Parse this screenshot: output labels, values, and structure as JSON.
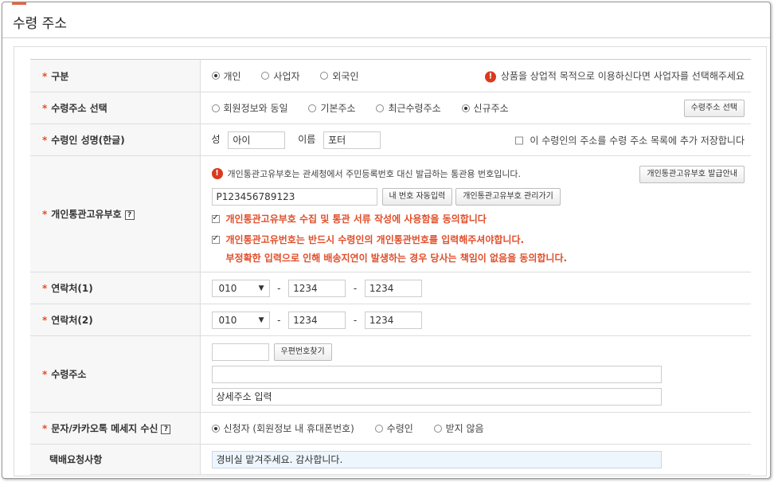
{
  "page": {
    "title": "수령 주소"
  },
  "fields": {
    "type": {
      "label": "구분",
      "options": [
        "개인",
        "사업자",
        "외국인"
      ],
      "selected": "개인",
      "notice": "상품을 상업적 목적으로 이용하신다면 사업자를 선택해주세요"
    },
    "address_select": {
      "label": "수령주소 선택",
      "options": [
        "회원정보와 동일",
        "기본주소",
        "최근수령주소",
        "신규주소"
      ],
      "selected": "신규주소",
      "button": "수령주소 선택"
    },
    "name": {
      "label": "수령인 성명(한글)",
      "last_label": "성",
      "last_value": "아이",
      "first_label": "이름",
      "first_value": "포터",
      "save_label": "이 수령인의 주소를 수령 주소 목록에 추가 저장합니다"
    },
    "customs": {
      "label": "개인통관고유부호",
      "help": "?",
      "info": "개인통관고유부호는 관세청에서 주민등록번호 대신 발급하는 통관용 번호입니다.",
      "guide_button": "개인통관고유부호 발급안내",
      "value": "P123456789123",
      "auto_button": "내 번호 자동입력",
      "manage_button": "개인통관고유부호 관리가기",
      "consent1": "개인통관고유부호 수집 및 통관 서류 작성에 사용함을 동의합니다",
      "consent2_line1": "개인통관고유번호는 반드시 수령인의 개인통관번호를 입력해주셔야합니다.",
      "consent2_line2": "부정확한 입력으로 인해 배송지연이 발생하는 경우 당사는 책임이 없음을 동의합니다."
    },
    "phone1": {
      "label": "연락처(1)",
      "prefix": "010",
      "mid": "1234",
      "last": "1234"
    },
    "phone2": {
      "label": "연락처(2)",
      "prefix": "010",
      "mid": "1234",
      "last": "1234"
    },
    "address": {
      "label": "수령주소",
      "zip_value": "",
      "zip_button": "우편번호찾기",
      "addr1_value": "",
      "addr2_placeholder": "상세주소 입력"
    },
    "sms": {
      "label": "문자/카카오톡 메세지 수신",
      "help": "?",
      "options": [
        "신청자 (회원정보 내 휴대폰번호)",
        "수령인",
        "받지 않음"
      ],
      "selected": "신청자 (회원정보 내 휴대폰번호)"
    },
    "request": {
      "label": "택배요청사항",
      "value": "경비실 맡겨주세요. 감사합니다."
    }
  },
  "colors": {
    "accent": "#e04e2a",
    "alert": "#d93a1e",
    "request_bg": "#eef6fd"
  }
}
